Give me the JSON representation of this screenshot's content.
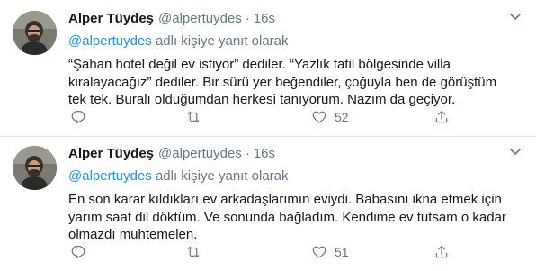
{
  "tweets": [
    {
      "display_name": "Alper Tüydeş",
      "handle": "@alpertuydes",
      "separator": "·",
      "time": "16s",
      "reply_mention": "@alpertuydes",
      "reply_suffix": " adlı kişiye yanıt olarak",
      "text": "“Şahan hotel değil ev istiyor” dediler. “Yazlık tatil bölgesinde villa kiralayacağız” dediler. Bir sürü yer beğendiler, çoğuyla ben de görüştüm tek tek. Buralı olduğumdan herkesi tanıyorum. Nazım da geçiyor.",
      "like_count": "52",
      "icons": {
        "reply": "reply-icon",
        "retweet": "retweet-icon",
        "like": "heart-icon",
        "share": "share-icon",
        "menu": "chevron-down-icon"
      }
    },
    {
      "display_name": "Alper Tüydeş",
      "handle": "@alpertuydes",
      "separator": "·",
      "time": "16s",
      "reply_mention": "@alpertuydes",
      "reply_suffix": " adlı kişiye yanıt olarak",
      "text": "En son karar kıldıkları ev arkadaşlarımın eviydi. Babasını ikna etmek için yarım saat dil döktüm. Ve sonunda bağladım. Kendime ev tutsam o kadar olmazdı muhtemelen.",
      "like_count": "51",
      "icons": {
        "reply": "reply-icon",
        "retweet": "retweet-icon",
        "like": "heart-icon",
        "share": "share-icon",
        "menu": "chevron-down-icon"
      }
    }
  ],
  "colors": {
    "text": "#14171a",
    "muted": "#657786",
    "link": "#1b95e0",
    "divider": "#e1e8ed"
  }
}
